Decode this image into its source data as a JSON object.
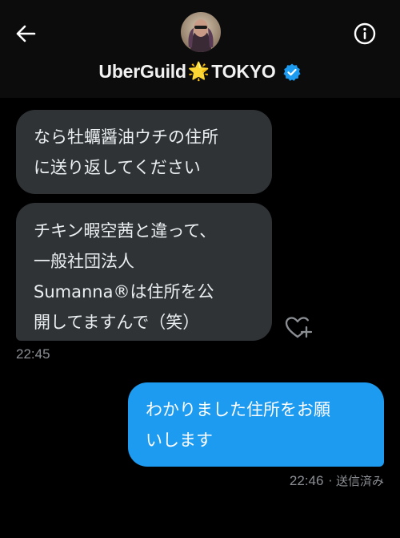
{
  "header": {
    "title_prefix": "UberGuild",
    "title_emoji": "🌟",
    "title_suffix": "TOKYO",
    "verified": true,
    "accent": "#1d9bf0"
  },
  "messages": [
    {
      "direction": "incoming",
      "lines": [
        "なら牡蠣醤油ウチの住所",
        "に送り返してください"
      ]
    },
    {
      "direction": "incoming",
      "lines": [
        "チキン暇空茜と違って、",
        "一般社団法人",
        "Sumanna®は住所を公",
        "開してますんで（笑）"
      ],
      "time": "22:45"
    },
    {
      "direction": "outgoing",
      "lines": [
        "わかりました住所をお願",
        "いします"
      ],
      "time": "22:46",
      "status": "· 送信済み"
    }
  ],
  "icons": {
    "back": "back-arrow-icon",
    "info": "info-icon",
    "reaction": "heart-plus-icon",
    "verified": "verified-badge-icon"
  },
  "colors": {
    "background": "#000000",
    "incoming_bubble": "#2f3336",
    "outgoing_bubble": "#1d9bf0",
    "meta_text": "#8b8f94"
  }
}
